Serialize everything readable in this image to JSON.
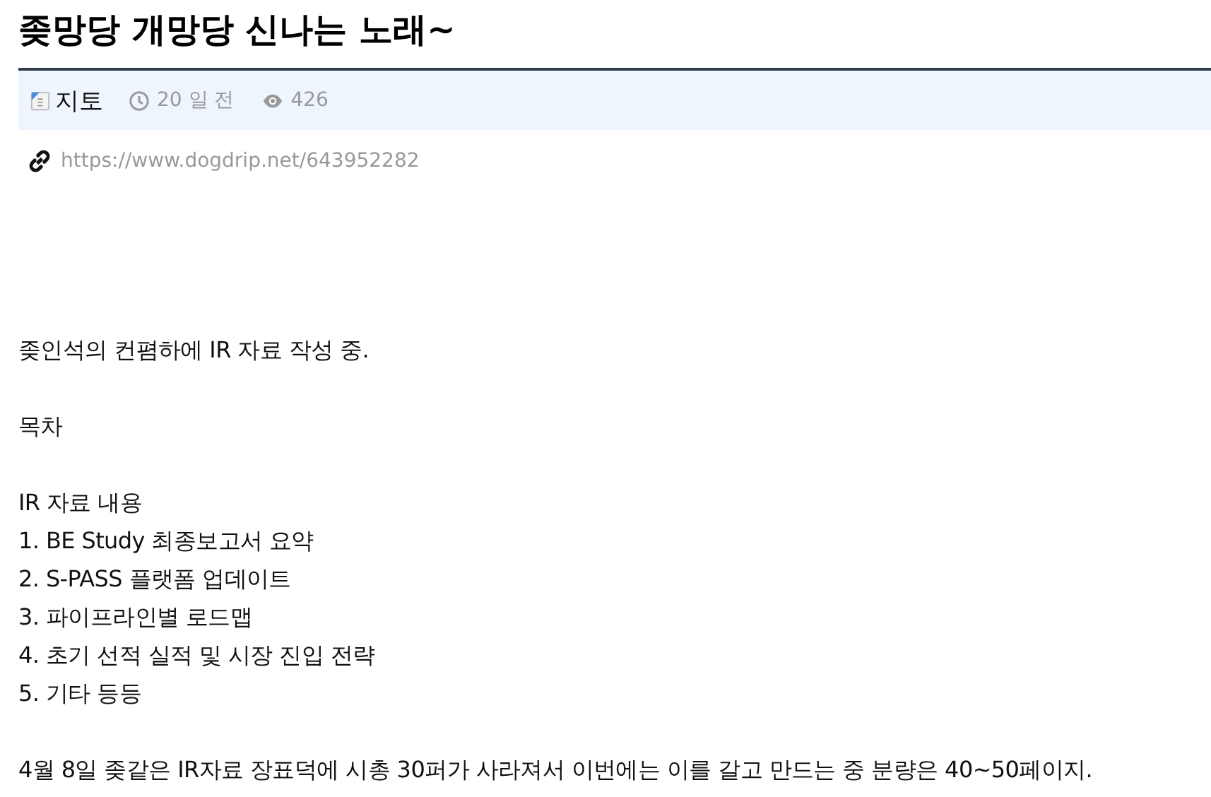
{
  "title": "좆망당 개망당 신나는 노래~",
  "meta": {
    "author": "지토",
    "time": "20 일 전",
    "views": "426"
  },
  "link": "https://www.dogdrip.net/643952282",
  "paragraphs": [
    {
      "lines": [
        "좆인석의 컨폄하에 IR 자료 작성 중."
      ]
    },
    {
      "lines": [
        "목차"
      ]
    },
    {
      "lines": [
        "IR 자료 내용",
        "1. BE Study 최종보고서 요약",
        "2. S-PASS 플랫폼 업데이트",
        "3. 파이프라인별 로드맵",
        "4. 초기 선적 실적 및 시장 진입 전략",
        "5. 기타 등등"
      ]
    },
    {
      "lines": [
        "4월 8일 좆같은 IR자료 장표덕에 시총 30퍼가 사라져서 이번에는 이를 갈고 만드는 중 분량은 40~50페이지."
      ]
    }
  ]
}
